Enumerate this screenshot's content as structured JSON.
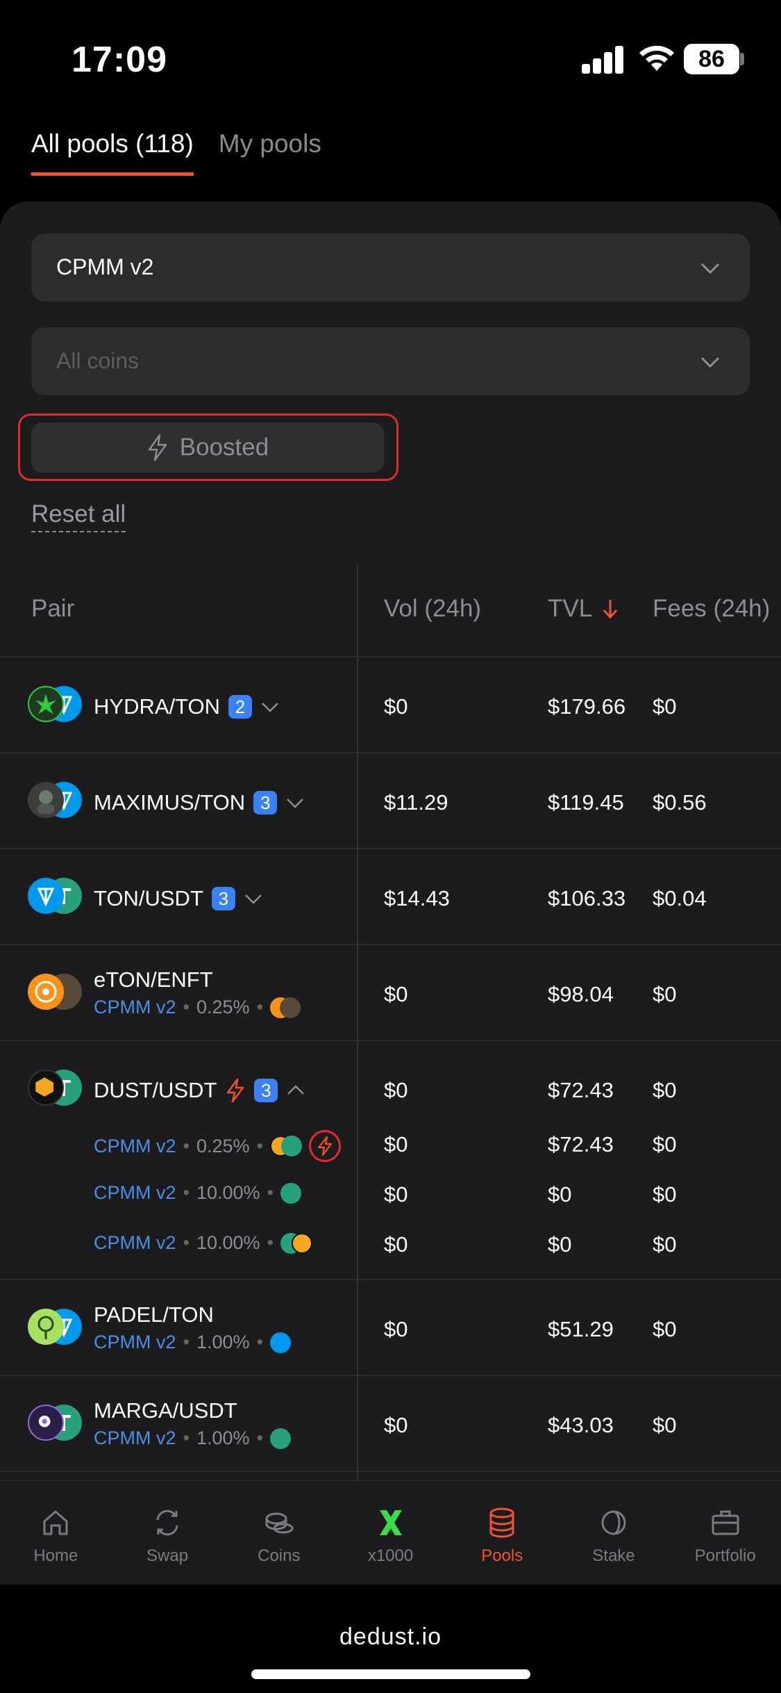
{
  "status": {
    "time": "17:09",
    "battery": "86"
  },
  "tabs": [
    {
      "label": "All pools (118)",
      "active": true
    },
    {
      "label": "My pools",
      "active": false
    }
  ],
  "filters": {
    "pool_type": "CPMM v2",
    "coins_placeholder": "All coins",
    "boosted_label": "Boosted",
    "reset_label": "Reset all"
  },
  "table": {
    "headers": {
      "pair": "Pair",
      "vol": "Vol (24h)",
      "tvl": "TVL",
      "fees": "Fees (24h)"
    },
    "rows": [
      {
        "pair": "HYDRA/TON",
        "badge": "2",
        "vol": "$0",
        "tvl": "$179.66",
        "fees": "$0"
      },
      {
        "pair": "MAXIMUS/TON",
        "badge": "3",
        "vol": "$11.29",
        "tvl": "$119.45",
        "fees": "$0.56"
      },
      {
        "pair": "TON/USDT",
        "badge": "3",
        "vol": "$14.43",
        "tvl": "$106.33",
        "fees": "$0.04"
      },
      {
        "pair": "eTON/ENFT",
        "protocol": "CPMM v2",
        "fee": "0.25%",
        "vol": "$0",
        "tvl": "$98.04",
        "fees": "$0"
      },
      {
        "pair": "DUST/USDT",
        "badge": "3",
        "vol": "$0",
        "tvl": "$72.43",
        "fees": "$0",
        "sub_pools": [
          {
            "protocol": "CPMM v2",
            "fee": "0.25%",
            "vol": "$0",
            "tvl": "$72.43",
            "fees": "$0"
          },
          {
            "protocol": "CPMM v2",
            "fee": "10.00%",
            "vol": "$0",
            "tvl": "$0",
            "fees": "$0"
          },
          {
            "protocol": "CPMM v2",
            "fee": "10.00%",
            "vol": "$0",
            "tvl": "$0",
            "fees": "$0"
          }
        ]
      },
      {
        "pair": "PADEL/TON",
        "protocol": "CPMM v2",
        "fee": "1.00%",
        "vol": "$0",
        "tvl": "$51.29",
        "fees": "$0"
      },
      {
        "pair": "MARGA/USDT",
        "protocol": "CPMM v2",
        "fee": "1.00%",
        "vol": "$0",
        "tvl": "$43.03",
        "fees": "$0"
      }
    ]
  },
  "nav": [
    {
      "label": "Home",
      "icon": "home-icon"
    },
    {
      "label": "Swap",
      "icon": "swap-icon"
    },
    {
      "label": "Coins",
      "icon": "coins-icon"
    },
    {
      "label": "x1000",
      "icon": "x1000-icon"
    },
    {
      "label": "Pools",
      "icon": "pools-icon",
      "active": true
    },
    {
      "label": "Stake",
      "icon": "stake-icon"
    },
    {
      "label": "Portfolio",
      "icon": "portfolio-icon"
    }
  ],
  "browser": {
    "url": "dedust.io"
  },
  "colors": {
    "accent": "#f0542d",
    "link": "#4a90e2",
    "badge": "#3b82f6",
    "highlight": "#e12b2b"
  }
}
